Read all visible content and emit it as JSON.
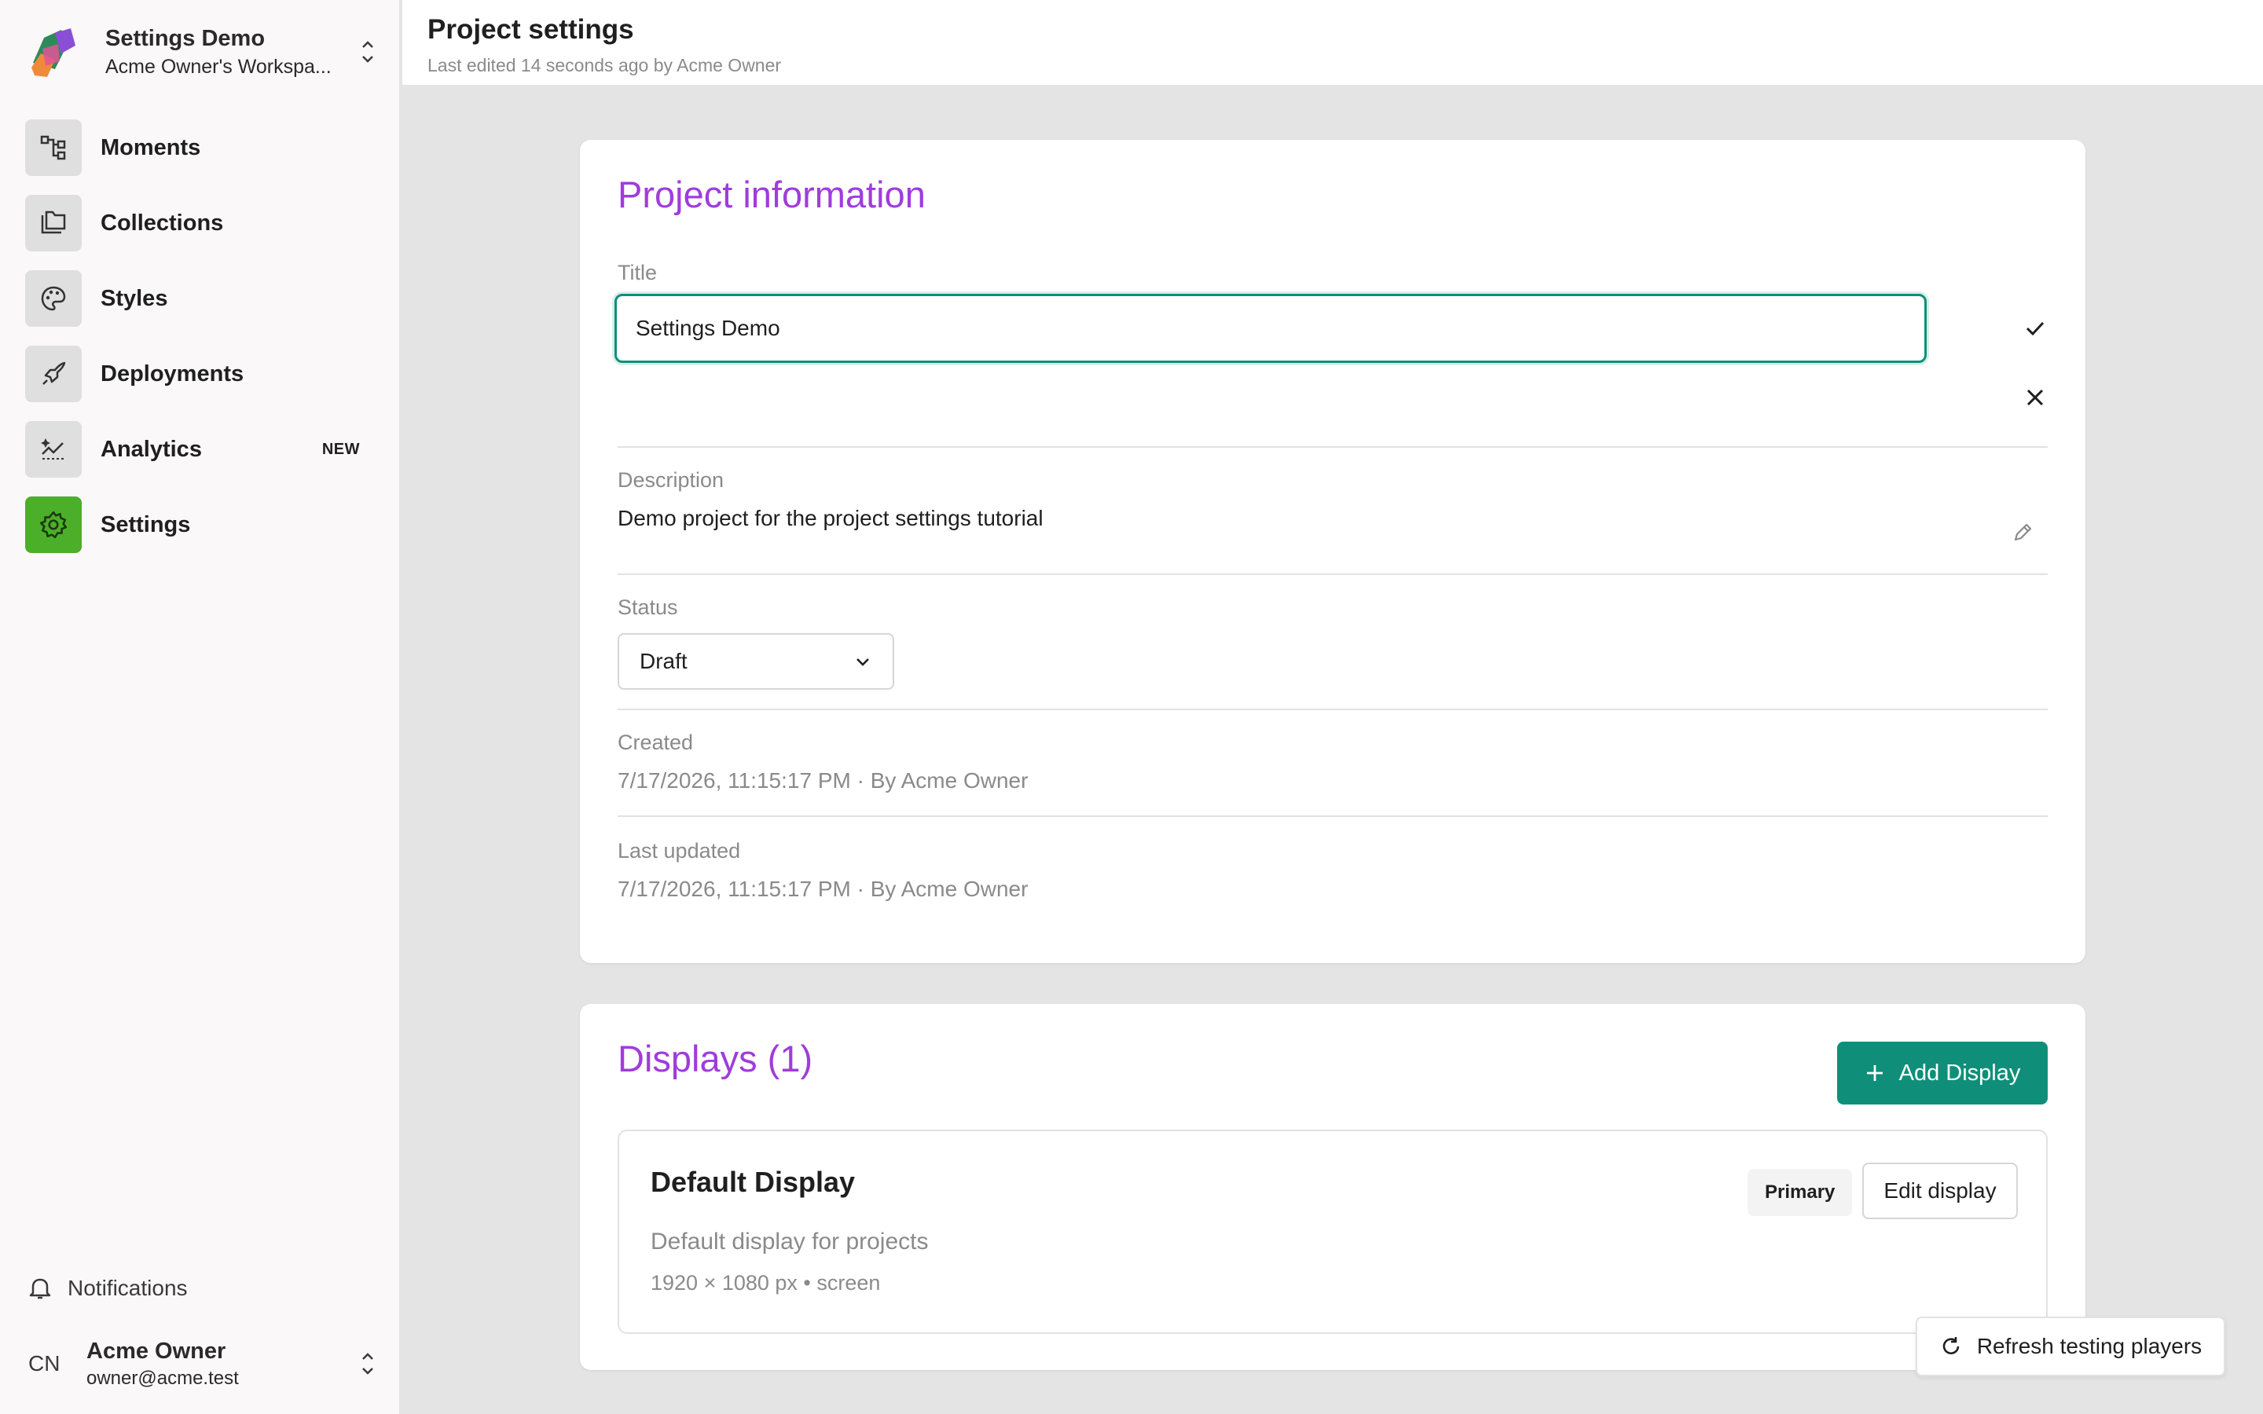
{
  "workspace": {
    "project_name": "Settings Demo",
    "workspace_name": "Acme Owner's Workspa..."
  },
  "sidebar": {
    "items": [
      {
        "label": "Moments",
        "icon": "flow-icon"
      },
      {
        "label": "Collections",
        "icon": "folders-icon"
      },
      {
        "label": "Styles",
        "icon": "palette-icon"
      },
      {
        "label": "Deployments",
        "icon": "rocket-icon"
      },
      {
        "label": "Analytics",
        "icon": "analytics-icon",
        "badge": "NEW"
      },
      {
        "label": "Settings",
        "icon": "gear-icon",
        "active": true
      }
    ],
    "notifications_label": "Notifications",
    "user": {
      "initials": "CN",
      "name": "Acme Owner",
      "email": "owner@acme.test"
    }
  },
  "header": {
    "title": "Project settings",
    "subtitle": "Last edited 14 seconds ago by Acme Owner"
  },
  "project_info": {
    "heading": "Project information",
    "title_label": "Title",
    "title_value": "Settings Demo",
    "description_label": "Description",
    "description_value": "Demo project for the project settings tutorial",
    "status_label": "Status",
    "status_value": "Draft",
    "created_label": "Created",
    "created_value": "7/17/2026, 11:15:17 PM · By Acme Owner",
    "updated_label": "Last updated",
    "updated_value": "7/17/2026, 11:15:17 PM · By Acme Owner"
  },
  "displays": {
    "heading": "Displays (1)",
    "add_label": "Add Display",
    "items": [
      {
        "name": "Default Display",
        "description": "Default display for projects",
        "meta": "1920 × 1080 px • screen",
        "badge": "Primary",
        "edit_label": "Edit display"
      }
    ]
  },
  "refresh_label": "Refresh testing players",
  "colors": {
    "accent_purple": "#a03cdc",
    "teal": "#0f8f7a",
    "settings_green": "#4caf2a"
  }
}
